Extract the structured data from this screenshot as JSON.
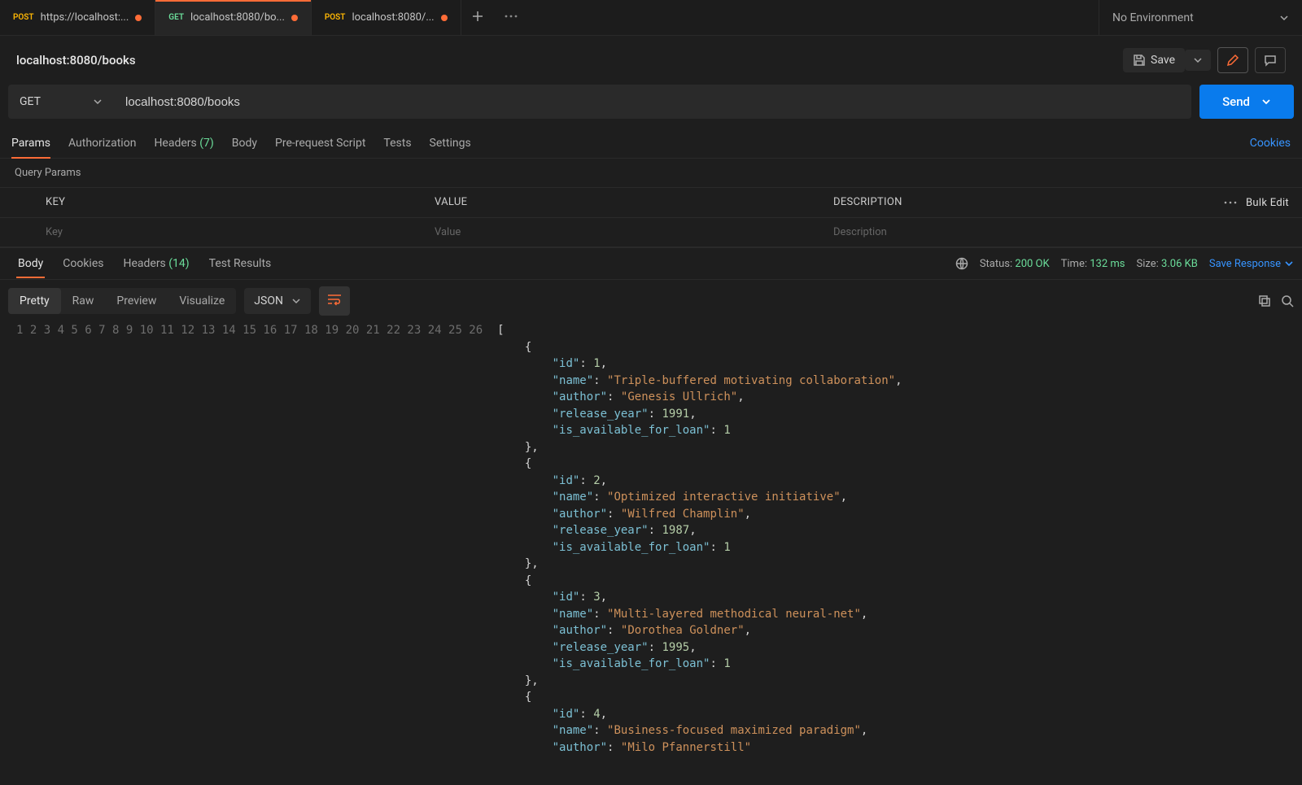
{
  "tabs": [
    {
      "method": "POST",
      "methodClass": "method-post",
      "label": "https://localhost:...",
      "dirty": true,
      "active": false
    },
    {
      "method": "GET",
      "methodClass": "method-get",
      "label": "localhost:8080/bo...",
      "dirty": true,
      "active": true
    },
    {
      "method": "POST",
      "methodClass": "method-post",
      "label": "localhost:8080/...",
      "dirty": true,
      "active": false
    }
  ],
  "env": {
    "label": "No Environment"
  },
  "request": {
    "title": "localhost:8080/books",
    "method": "GET",
    "url": "localhost:8080/books",
    "sendLabel": "Send",
    "saveLabel": "Save"
  },
  "requestTabs": [
    "Params",
    "Authorization",
    "Headers",
    "Body",
    "Pre-request Script",
    "Tests",
    "Settings"
  ],
  "requestHeadersCount": "(7)",
  "cookiesLink": "Cookies",
  "queryParamsLabel": "Query Params",
  "paramsTable": {
    "headers": {
      "key": "KEY",
      "value": "VALUE",
      "desc": "DESCRIPTION"
    },
    "bulkEdit": "Bulk Edit",
    "placeholder": {
      "key": "Key",
      "value": "Value",
      "desc": "Description"
    }
  },
  "responseTabs": [
    "Body",
    "Cookies",
    "Headers",
    "Test Results"
  ],
  "responseHeadersCount": "(14)",
  "status": {
    "label": "Status:",
    "code": "200 OK",
    "timeLabel": "Time:",
    "time": "132 ms",
    "sizeLabel": "Size:",
    "size": "3.06 KB"
  },
  "saveResponse": "Save Response",
  "viewerModes": [
    "Pretty",
    "Raw",
    "Preview",
    "Visualize"
  ],
  "formatLabel": "JSON",
  "responseBody": [
    {
      "id": 1,
      "name": "Triple-buffered motivating collaboration",
      "author": "Genesis Ullrich",
      "release_year": 1991,
      "is_available_for_loan": 1
    },
    {
      "id": 2,
      "name": "Optimized interactive initiative",
      "author": "Wilfred Champlin",
      "release_year": 1987,
      "is_available_for_loan": 1
    },
    {
      "id": 3,
      "name": "Multi-layered methodical neural-net",
      "author": "Dorothea Goldner",
      "release_year": 1995,
      "is_available_for_loan": 1
    },
    {
      "id": 4,
      "name": "Business-focused maximized paradigm",
      "author": "Milo Pfannerstill"
    }
  ]
}
